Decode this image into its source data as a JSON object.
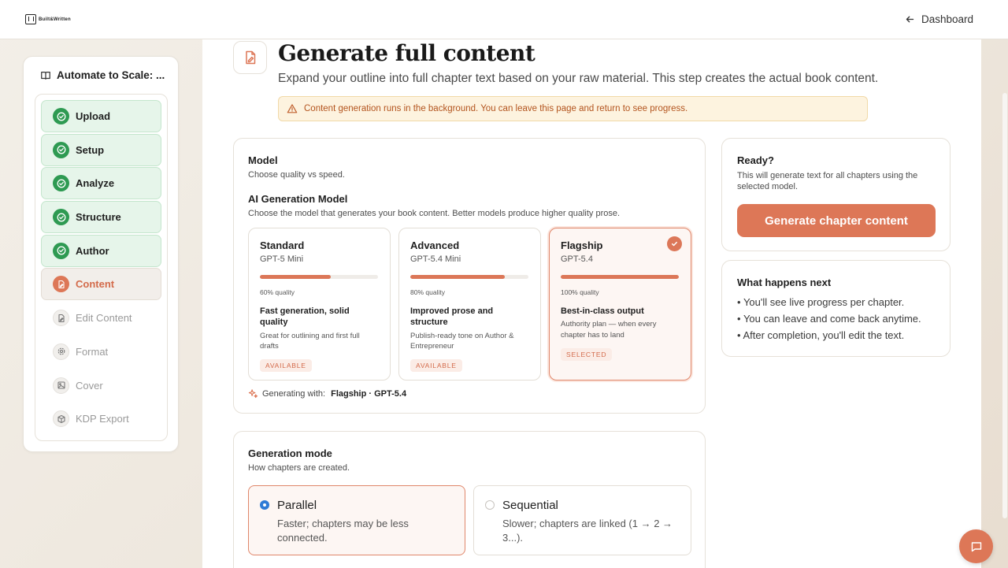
{
  "app": {
    "logo_text": "Built&Written"
  },
  "topbar": {
    "dashboard_label": "Dashboard"
  },
  "sidebar": {
    "project_title": "Automate to Scale: ...",
    "steps": [
      {
        "label": "Upload",
        "state": "done",
        "icon": "check-circle-icon"
      },
      {
        "label": "Setup",
        "state": "done",
        "icon": "check-circle-icon"
      },
      {
        "label": "Analyze",
        "state": "done",
        "icon": "check-circle-icon"
      },
      {
        "label": "Structure",
        "state": "done",
        "icon": "check-circle-icon"
      },
      {
        "label": "Author",
        "state": "done",
        "icon": "check-circle-icon"
      },
      {
        "label": "Content",
        "state": "active",
        "icon": "file-pen-icon"
      },
      {
        "label": "Edit Content",
        "state": "todo",
        "icon": "file-edit-icon"
      },
      {
        "label": "Format",
        "state": "todo",
        "icon": "gear-icon"
      },
      {
        "label": "Cover",
        "state": "todo",
        "icon": "image-icon"
      },
      {
        "label": "KDP Export",
        "state": "todo",
        "icon": "package-icon"
      }
    ]
  },
  "header": {
    "title": "Generate full content",
    "subtitle": "Expand your outline into full chapter text based on your raw material. This step creates the actual book content.",
    "notice": "Content generation runs in the background. You can leave this page and return to see progress."
  },
  "model_card": {
    "title": "Model",
    "subtitle": "Choose quality vs speed.",
    "section_title": "AI Generation Model",
    "section_subtitle": "Choose the model that generates your book content. Better models produce higher quality prose.",
    "options": [
      {
        "name": "Standard",
        "model": "GPT-5 Mini",
        "quality": 0.6,
        "quality_label": "60% quality",
        "feature": "Fast generation, solid quality",
        "description": "Great for outlining and first full drafts",
        "badge": "AVAILABLE",
        "selected": false
      },
      {
        "name": "Advanced",
        "model": "GPT-5.4 Mini",
        "quality": 0.8,
        "quality_label": "80% quality",
        "feature": "Improved prose and structure",
        "description": "Publish-ready tone on Author & Entrepreneur",
        "badge": "AVAILABLE",
        "selected": false
      },
      {
        "name": "Flagship",
        "model": "GPT-5.4",
        "quality": 1.0,
        "quality_label": "100% quality",
        "feature": "Best-in-class output",
        "description": "Authority plan — when every chapter has to land",
        "badge": "SELECTED",
        "selected": true
      }
    ],
    "generating_with_label": "Generating with:",
    "generating_with_value": "Flagship · GPT-5.4"
  },
  "mode_card": {
    "title": "Generation mode",
    "subtitle": "How chapters are created.",
    "modes": [
      {
        "name": "Parallel",
        "description": "Faster; chapters may be less connected.",
        "selected": true
      },
      {
        "name": "Sequential",
        "description": "Slower; chapters are linked (1 → 2 → 3...).",
        "selected": false
      }
    ]
  },
  "ready_card": {
    "title": "Ready?",
    "description": "This will generate text for all chapters using the selected model.",
    "button_label": "Generate chapter content"
  },
  "next_card": {
    "title": "What happens next",
    "items": [
      "You'll see live progress per chapter.",
      "You can leave and come back anytime.",
      "After completion, you'll edit the text."
    ]
  },
  "colors": {
    "accent": "#dd7757",
    "success": "#2e9a52",
    "notice_bg": "#fdf3df",
    "notice_text": "#b3541e"
  }
}
